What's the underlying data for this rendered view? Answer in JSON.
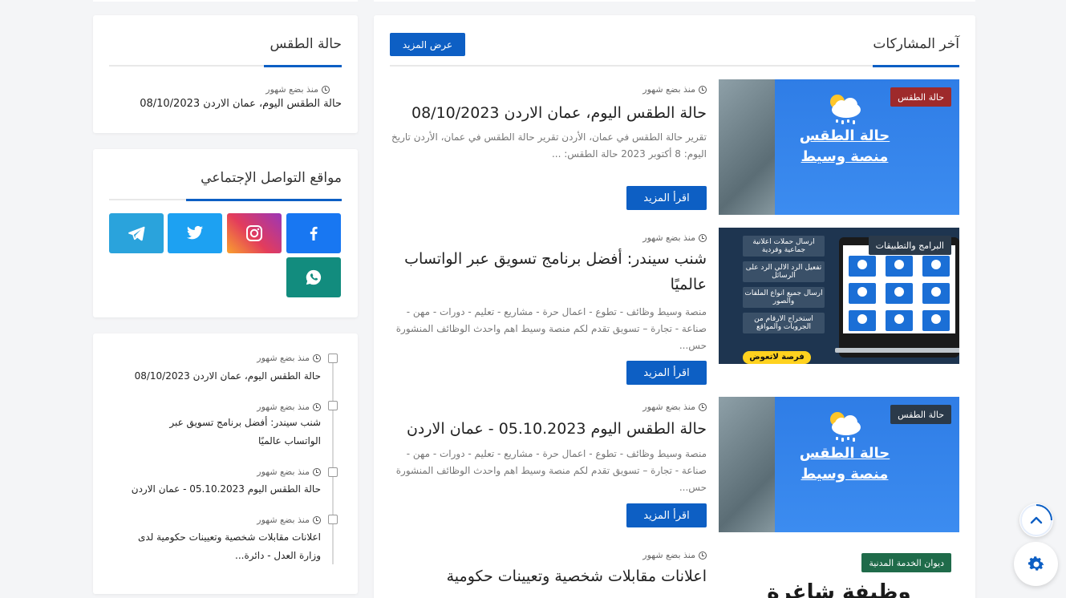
{
  "recent": {
    "heading": "آخر المشاركات",
    "view_more": "عرض المزيد",
    "read_more": "اقرأ المزيد",
    "posts": [
      {
        "time": "منذ بضع شهور",
        "title": "حالة الطقس اليوم، عمان الاردن 08/10/2023",
        "excerpt": "تقرير حالة الطقس في عمان، الأردن تقرير حالة الطقس في عمان، الأردن تاريخ اليوم: 8 أكتوبر 2023 حالة الطقس: ...",
        "tag": "حالة الطقس",
        "tag_color": "#9e2a2b",
        "thumb_text1": "حالة الطقس",
        "thumb_text2": "منصة وسيط"
      },
      {
        "time": "منذ بضع شهور",
        "title": "شنب سيندر: أفضل برنامج تسويق عبر الواتساب عالميًا",
        "excerpt": "منصة وسيط وظائف - تطوع - اعمال حرة - مشاريع - تعليم - دورات - مهن - صناعة - تجارة – تسويق تقدم لكم منصة وسيط اهم واحدث الوظائف المنشورة حس...",
        "tag": "البرامج والتطبيقات",
        "tag_color": "#2b3a4a",
        "promo_items": [
          "ارسال حملات اعلانية جماعية وفردية",
          "تفعيل الرد الالي الرد على الرسائل",
          "ارسال جميع انواع الملفات والصور",
          "استخراج الارقام من الجروبات والمواقع"
        ],
        "promo_badge": "فرصة لاتعوض"
      },
      {
        "time": "منذ بضع شهور",
        "title": "حالة الطقس اليوم 05.10.2023 - عمان الاردن",
        "excerpt": "منصة وسيط وظائف - تطوع - اعمال حرة - مشاريع - تعليم - دورات - مهن - صناعة - تجارة – تسويق تقدم لكم منصة وسيط اهم واحدث الوظائف المنشورة حس...",
        "tag": "حالة الطقس",
        "tag_color": "#2b3a4a",
        "thumb_text1": "حالة الطقس",
        "thumb_text2": "منصة وسيط"
      },
      {
        "time": "منذ بضع شهور",
        "title": "اعلانات مقابلات شخصية وتعيينات حكومية",
        "tag": "ديوان الخدمة المدنية",
        "tag_color": "#1f6b4a",
        "thumb_text1": "وظيفة شاغرة"
      }
    ]
  },
  "weather": {
    "heading": "حالة الطقس",
    "time": "منذ بضع شهور",
    "title": "حالة الطقس اليوم، عمان الاردن 08/10/2023"
  },
  "social": {
    "heading": "مواقع التواصل الإجتماعي",
    "items": [
      {
        "icon": "facebook-icon",
        "color": "#1877f2"
      },
      {
        "icon": "instagram-icon",
        "color": "#d62976"
      },
      {
        "icon": "twitter-icon",
        "color": "#1da1f2"
      },
      {
        "icon": "telegram-icon",
        "color": "#2aa3dc"
      },
      {
        "icon": "whatsapp-icon",
        "color": "#128c7e"
      }
    ]
  },
  "timeline": {
    "items": [
      {
        "time": "منذ بضع شهور",
        "title": "حالة الطقس اليوم، عمان الاردن 08/10/2023"
      },
      {
        "time": "منذ بضع شهور",
        "title": "شنب سيندر: أفضل برنامج تسويق عبر الواتساب عالميًا"
      },
      {
        "time": "منذ بضع شهور",
        "title": "حالة الطقس اليوم 05.10.2023 - عمان الاردن"
      },
      {
        "time": "منذ بضع شهور",
        "title": "اعلانات مقابلات شخصية وتعيينات حكومية لدى وزارة العدل - دائرة..."
      }
    ]
  },
  "accent_color": "#0d5fc4"
}
